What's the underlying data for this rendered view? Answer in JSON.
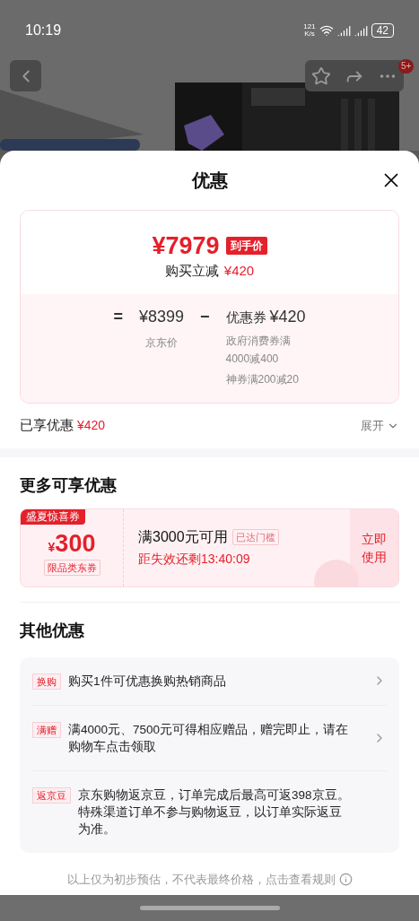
{
  "status_bar": {
    "time": "10:19",
    "speed": "121\nK/s",
    "battery": "42"
  },
  "top_bar": {
    "badge": "5+"
  },
  "sheet": {
    "title": "优惠"
  },
  "price_card": {
    "price": "¥7979",
    "price_tag": "到手价",
    "saving_label": "购买立减",
    "saving_amount": "¥420",
    "equals": "=",
    "base_price": "¥8399",
    "minus": "−",
    "coupon_label": "优惠券",
    "coupon_amount": "¥420",
    "base_caption": "京东价",
    "coupon_details": [
      "政府消费券满\n4000减400",
      "神券满200减20"
    ]
  },
  "enjoyed": {
    "label": "已享优惠",
    "amount": "¥420",
    "toggle": "展开"
  },
  "more_section": {
    "title": "更多可享优惠",
    "coupon": {
      "ribbon": "盛夏惊喜券",
      "currency": "¥",
      "amount": "300",
      "scope": "限品类东券",
      "condition": "满3000元可用",
      "status_tag": "已达门槛",
      "countdown": "距失效还剩13:40:09",
      "action": "立即使用"
    }
  },
  "other_section": {
    "title": "其他优惠",
    "items": [
      {
        "tag": "换购",
        "text": "购买1件可优惠换购热销商品",
        "has_arrow": true
      },
      {
        "tag": "满赠",
        "text": "满4000元、7500元可得相应赠品，赠完即止，请在购物车点击领取",
        "has_arrow": true
      },
      {
        "tag": "返京豆",
        "text": "京东购物返京豆，订单完成后最高可返398京豆。特殊渠道订单不参与购物返豆，以订单实际返豆为准。",
        "has_arrow": false
      }
    ]
  },
  "footer": {
    "note": "以上仅为初步预估，不代表最终价格，点击查看规则"
  }
}
